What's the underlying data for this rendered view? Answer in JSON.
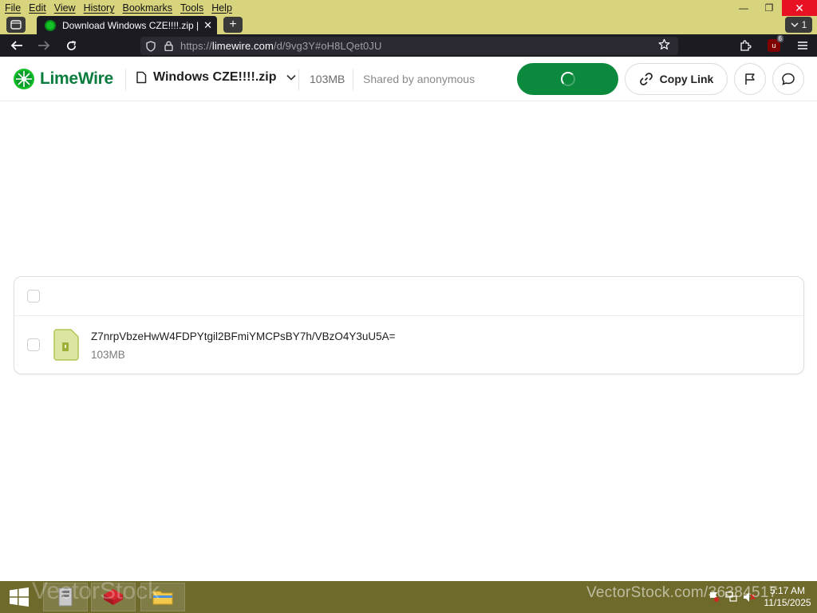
{
  "browser": {
    "menu": [
      "File",
      "Edit",
      "View",
      "History",
      "Bookmarks",
      "Tools",
      "Help"
    ],
    "window_controls": {
      "minimize": "—",
      "restore": "❐",
      "close": "✕"
    },
    "tab": {
      "title": "Download Windows CZE!!!!.zip |",
      "close": "✕"
    },
    "new_tab": "+",
    "tab_count": "1",
    "url": {
      "prefix": "https://",
      "domain": "limewire.com",
      "path": "/d/9vg3Y#oH8LQet0JU"
    },
    "extension_badge": "6"
  },
  "app": {
    "brand": "LimeWire",
    "file_name": "Windows CZE!!!!.zip",
    "file_size": "103MB",
    "shared_by": "Shared by anonymous",
    "copy_link_label": "Copy Link",
    "colors": {
      "brand_green": "#0b8a3e",
      "lime": "#13c026"
    }
  },
  "file_list": {
    "items": [
      {
        "name": "Z7nrpVbzeHwW4FDPYtgil2BFmiYMCPsBY7h/VBzO4Y3uU5A=",
        "size": "103MB"
      }
    ]
  },
  "taskbar": {
    "time": "5:17 AM",
    "date": "11/15/2025",
    "watermark": "VectorStock.com/36384517",
    "watermark_logo": "VectorStock"
  }
}
